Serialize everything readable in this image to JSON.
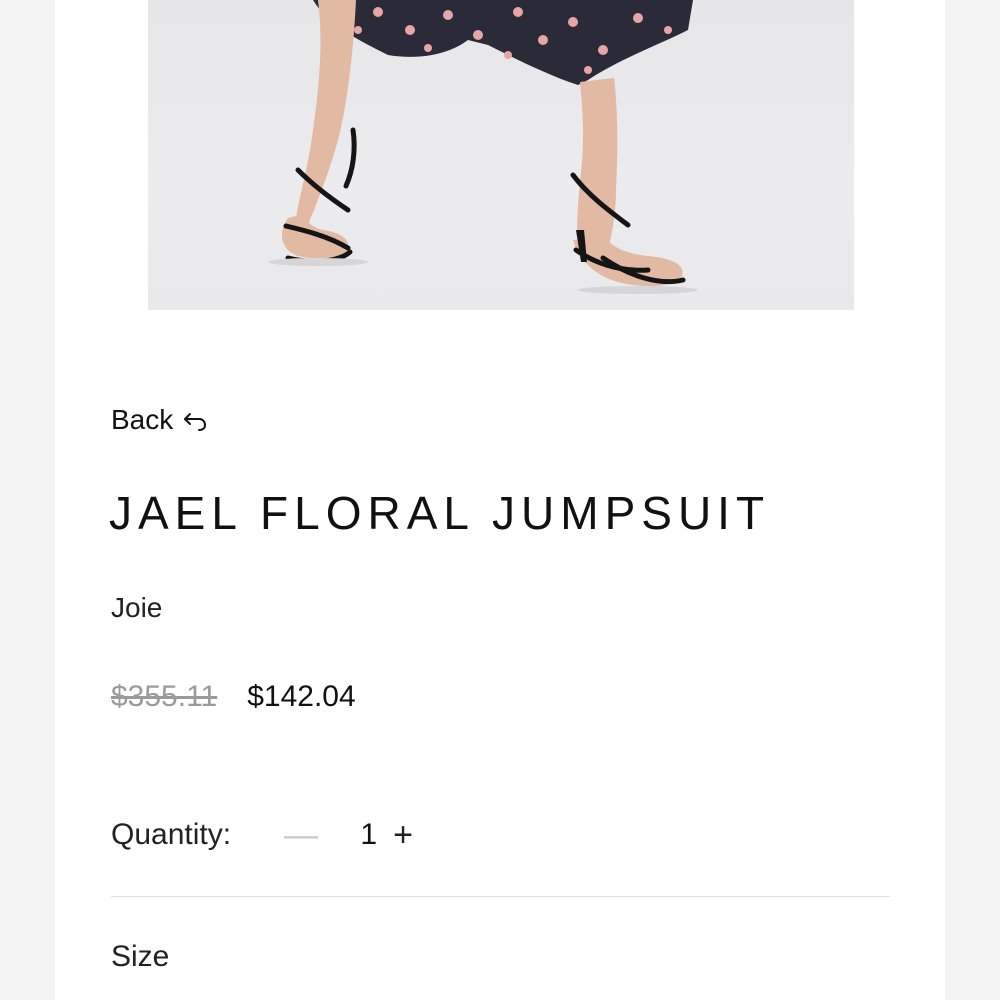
{
  "product": {
    "back_label": "Back",
    "title": "JAEL FLORAL JUMPSUIT",
    "brand": "Joie",
    "original_price": "$355.11",
    "sale_price": "$142.04"
  },
  "quantity": {
    "label": "Quantity:",
    "minus_symbol": "—",
    "value": "1",
    "plus_symbol": "+"
  },
  "size": {
    "label": "Size"
  },
  "icons": {
    "back": "return-arrow-icon",
    "minus": "minus-icon",
    "plus": "plus-icon"
  },
  "colors": {
    "background": "#f4f4f4",
    "card": "#ffffff",
    "text": "#111111",
    "muted_price": "#9a9a9a",
    "disabled_minus": "#c8c8c8",
    "divider": "#e0e0e0"
  }
}
